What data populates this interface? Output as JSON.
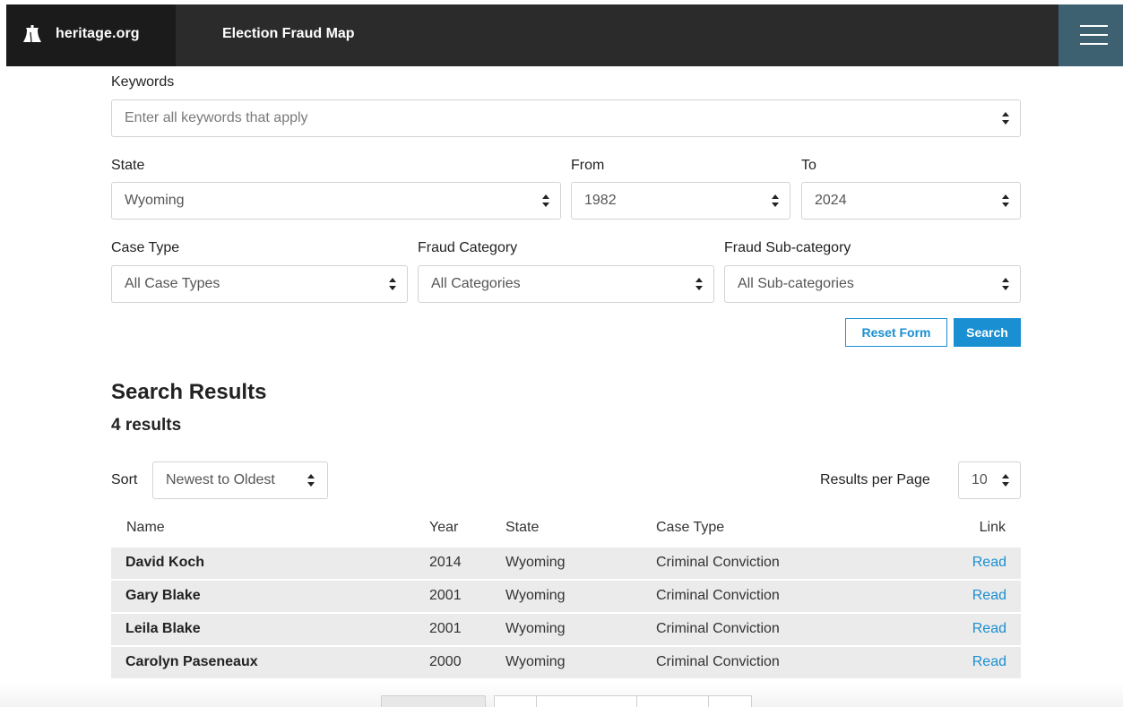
{
  "header": {
    "brand": "heritage.org",
    "title": "Election Fraud Map"
  },
  "form": {
    "keywords_label": "Keywords",
    "keywords_placeholder": "Enter all keywords that apply",
    "state_label": "State",
    "state_value": "Wyoming",
    "from_label": "From",
    "from_value": "1982",
    "to_label": "To",
    "to_value": "2024",
    "case_type_label": "Case Type",
    "case_type_value": "All Case Types",
    "fraud_category_label": "Fraud Category",
    "fraud_category_value": "All Categories",
    "fraud_subcategory_label": "Fraud Sub-category",
    "fraud_subcategory_value": "All Sub-categories",
    "reset_label": "Reset Form",
    "search_label": "Search"
  },
  "results": {
    "heading": "Search Results",
    "count": "4 results",
    "sort_label": "Sort",
    "sort_value": "Newest to Oldest",
    "per_page_label": "Results per Page",
    "per_page_value": "10",
    "columns": [
      "Name",
      "Year",
      "State",
      "Case Type",
      "Link"
    ],
    "rows": [
      {
        "name": "David Koch",
        "year": "2014",
        "state": "Wyoming",
        "type": "Criminal Conviction",
        "link": "Read"
      },
      {
        "name": "Gary Blake",
        "year": "2001",
        "state": "Wyoming",
        "type": "Criminal Conviction",
        "link": "Read"
      },
      {
        "name": "Leila Blake",
        "year": "2001",
        "state": "Wyoming",
        "type": "Criminal Conviction",
        "link": "Read"
      },
      {
        "name": "Carolyn Paseneaux",
        "year": "2000",
        "state": "Wyoming",
        "type": "Criminal Conviction",
        "link": "Read"
      }
    ]
  },
  "icons": {
    "logo": "liberty-bell-icon",
    "menu": "hamburger-menu-icon",
    "select": "up-down-caret-icon"
  },
  "colors": {
    "header_bg": "#2b2b2b",
    "brand_bg": "#1b1b1b",
    "menu_bg": "#3e6172",
    "accent": "#1a8fd1",
    "row_bg": "#ebebeb"
  }
}
